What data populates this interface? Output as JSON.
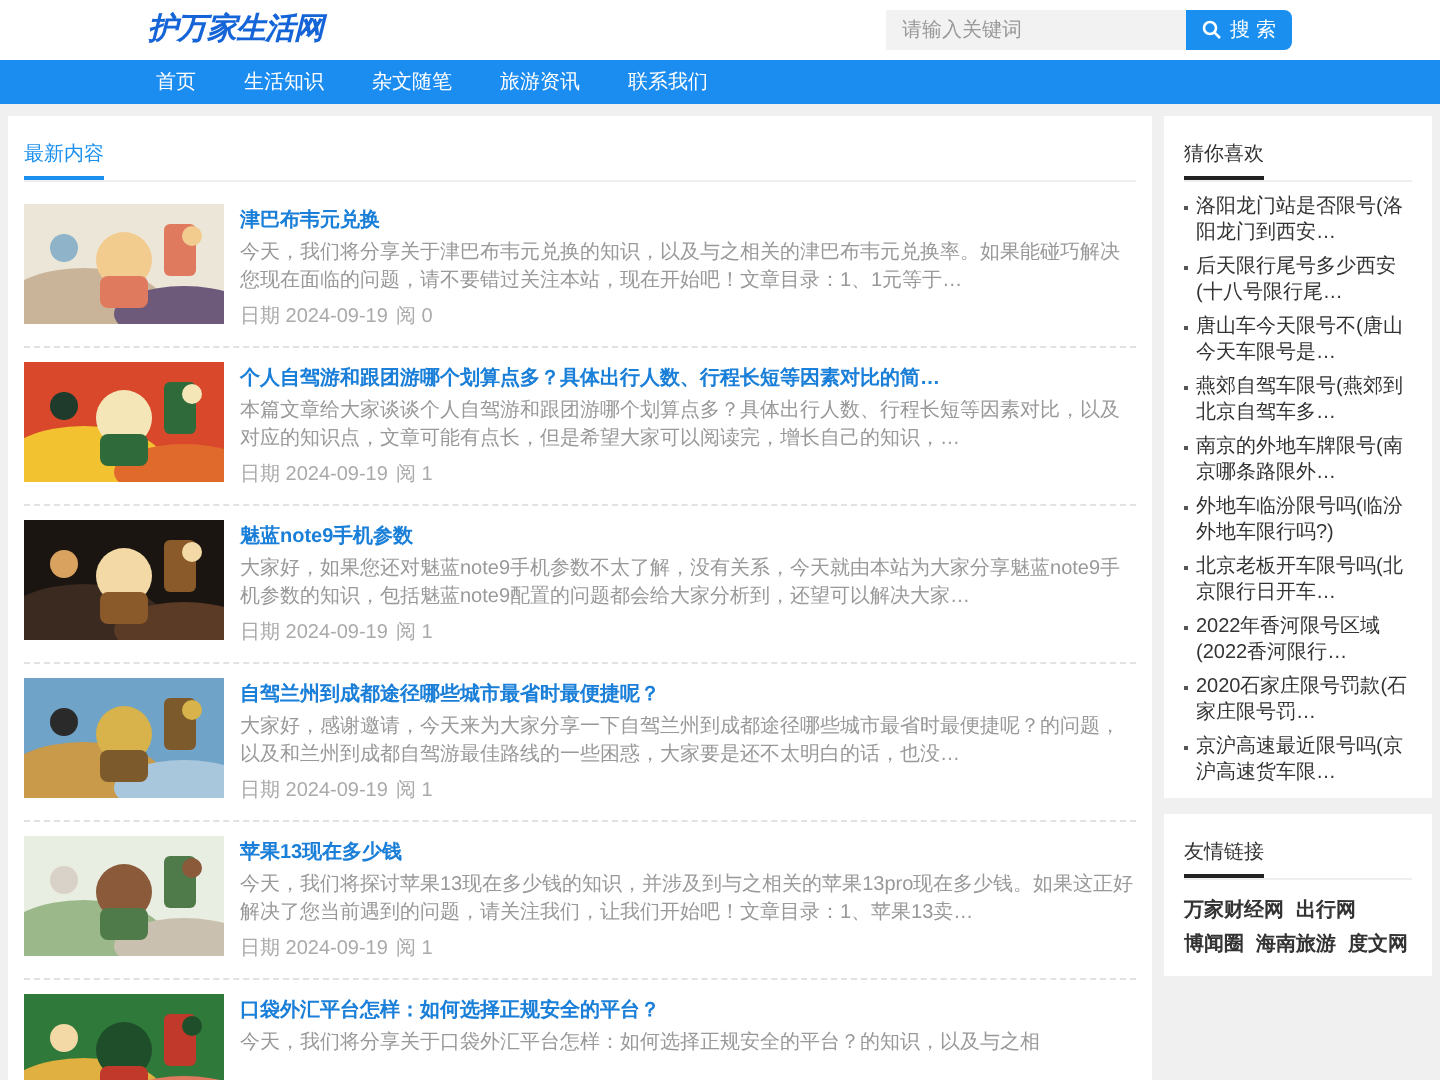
{
  "header": {
    "logo": "护万家生活网",
    "search": {
      "placeholder": "请输入关键词",
      "button": "搜 索"
    }
  },
  "nav": [
    "首页",
    "生活知识",
    "杂文随笔",
    "旅游资讯",
    "联系我们"
  ],
  "latest": {
    "heading": "最新内容",
    "articles": [
      {
        "title": "津巴布韦元兑换",
        "excerpt": "今天，我们将分享关于津巴布韦元兑换的知识，以及与之相关的津巴布韦元兑换率。如果能碰巧解决您现在面临的问题，请不要错过关注本站，现在开始吧！文章目录：1、1元等于…",
        "date": "日期 2024-09-19",
        "views": "阅 0"
      },
      {
        "title": "个人自驾游和跟团游哪个划算点多？具体出行人数、行程长短等因素对比的简…",
        "excerpt": "本篇文章给大家谈谈个人自驾游和跟团游哪个划算点多？具体出行人数、行程长短等因素对比，以及对应的知识点，文章可能有点长，但是希望大家可以阅读完，增长自己的知识，…",
        "date": "日期 2024-09-19",
        "views": "阅 1"
      },
      {
        "title": "魅蓝note9手机参数",
        "excerpt": "大家好，如果您还对魅蓝note9手机参数不太了解，没有关系，今天就由本站为大家分享魅蓝note9手机参数的知识，包括魅蓝note9配置的问题都会给大家分析到，还望可以解决大家…",
        "date": "日期 2024-09-19",
        "views": "阅 1"
      },
      {
        "title": "自驾兰州到成都途径哪些城市最省时最便捷呢？",
        "excerpt": "大家好，感谢邀请，今天来为大家分享一下自驾兰州到成都途径哪些城市最省时最便捷呢？的问题，以及和兰州到成都自驾游最佳路线的一些困惑，大家要是还不太明白的话，也没…",
        "date": "日期 2024-09-19",
        "views": "阅 1"
      },
      {
        "title": "苹果13现在多少钱",
        "excerpt": "今天，我们将探讨苹果13现在多少钱的知识，并涉及到与之相关的苹果13pro现在多少钱。如果这正好解决了您当前遇到的问题，请关注我们，让我们开始吧！文章目录：1、苹果13卖…",
        "date": "日期 2024-09-19",
        "views": "阅 1"
      },
      {
        "title": "口袋外汇平台怎样：如何选择正规安全的平台？",
        "excerpt": "今天，我们将分享关于口袋外汇平台怎样：如何选择正规安全的平台？的知识，以及与之相"
      }
    ]
  },
  "guess": {
    "heading": "猜你喜欢",
    "items": [
      "洛阳龙门站是否限号(洛阳龙门到西安…",
      "后天限行尾号多少西安(十八号限行尾…",
      "唐山车今天限号不(唐山今天车限号是…",
      "燕郊自驾车限号(燕郊到北京自驾车多…",
      "南京的外地车牌限号(南京哪条路限外…",
      "外地车临汾限号吗(临汾外地车限行吗?)",
      "北京老板开车限号吗(北京限行日开车…",
      "2022年香河限号区域(2022香河限行…",
      "2020石家庄限号罚款(石家庄限号罚…",
      "京沪高速最近限号吗(京沪高速货车限…"
    ]
  },
  "links": {
    "heading": "友情链接",
    "items": [
      "万家财经网",
      "出行网",
      "博闻圈",
      "海南旅游",
      "度文网"
    ]
  }
}
